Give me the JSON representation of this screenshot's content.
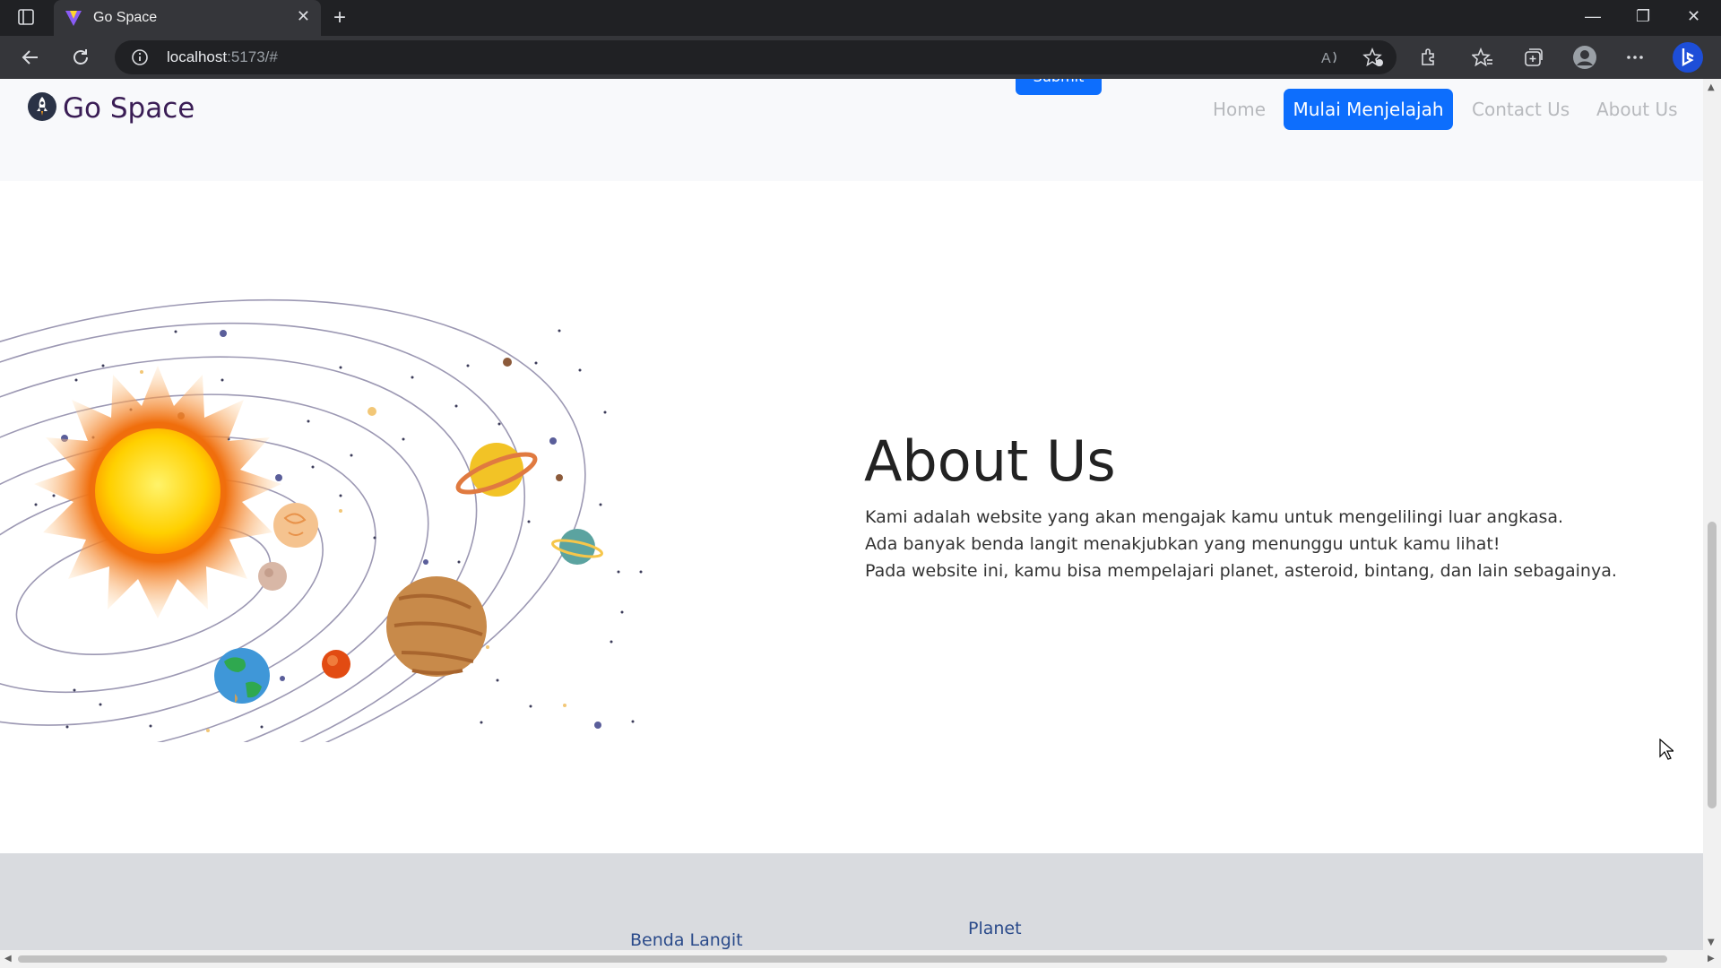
{
  "browser": {
    "tab_title": "Go Space",
    "new_tab_symbol": "+",
    "close_symbol": "✕",
    "url_host": "localhost",
    "url_rest": ":5173/#",
    "window_controls": [
      "—",
      "❐",
      "✕"
    ]
  },
  "navbar": {
    "brand": "Go Space",
    "submit_peek": "Submit",
    "links": {
      "home": "Home",
      "cta": "Mulai Menjelajah",
      "contact": "Contact Us",
      "about": "About Us"
    }
  },
  "about": {
    "title": "About Us",
    "lines": [
      "Kami adalah website yang akan mengajak kamu untuk mengelilingi luar angkasa.",
      "Ada banyak benda langit menakjubkan yang menunggu untuk kamu lihat!",
      "Pada website ini, kamu bisa mempelajari planet, asteroid, bintang, dan lain sebagainya."
    ]
  },
  "footer": {
    "link1": "Benda Langit",
    "link2": "Planet"
  },
  "colors": {
    "primary": "#0d6efd",
    "brand_text": "#3a1d55",
    "footer_bg": "#d9dbdf"
  }
}
